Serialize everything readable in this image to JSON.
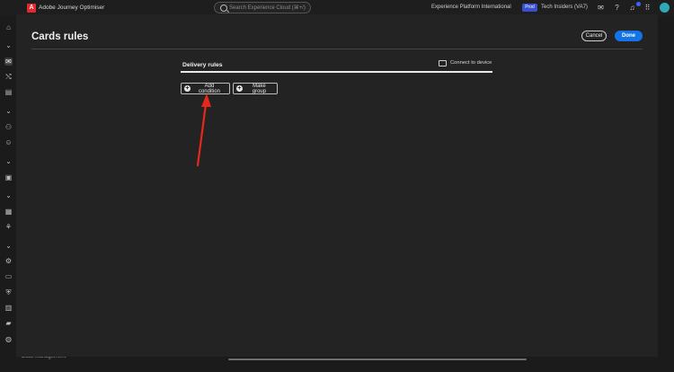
{
  "app": {
    "logo": "A",
    "title": "Adobe Journey Optimiser"
  },
  "search": {
    "placeholder": "Search Experience Cloud (⌘+/)"
  },
  "header": {
    "org_name": "Experience Platform International",
    "sandbox_badge": "Prod",
    "sandbox_name": "Tech Insiders (VA7)"
  },
  "header_icons": [
    "help-icon",
    "question-icon",
    "bell-icon",
    "apps-grid-icon"
  ],
  "rail_icons": [
    "home-icon",
    "chevron-icon",
    "message-icon",
    "journey-icon",
    "document-icon",
    "chevron-icon",
    "audience-icon",
    "profile-icon",
    "chevron-icon",
    "content-icon",
    "chevron-icon",
    "calendar-icon",
    "assets-icon",
    "chevron-icon",
    "settings-icon",
    "monitor-icon",
    "shield-icon",
    "reports-icon",
    "folder-icon",
    "globe-icon"
  ],
  "bottom": {
    "label": "Data management"
  },
  "modal": {
    "title": "Cards rules",
    "cancel_label": "Cancel",
    "done_label": "Done",
    "section_title": "Delivery rules",
    "connect_label": "Connect to device",
    "add_condition_label": "Add condition",
    "make_group_label": "Make group"
  },
  "colors": {
    "accent": "#1473e6",
    "annotation_arrow": "#e5281b",
    "badge": "#3a4ed0"
  }
}
